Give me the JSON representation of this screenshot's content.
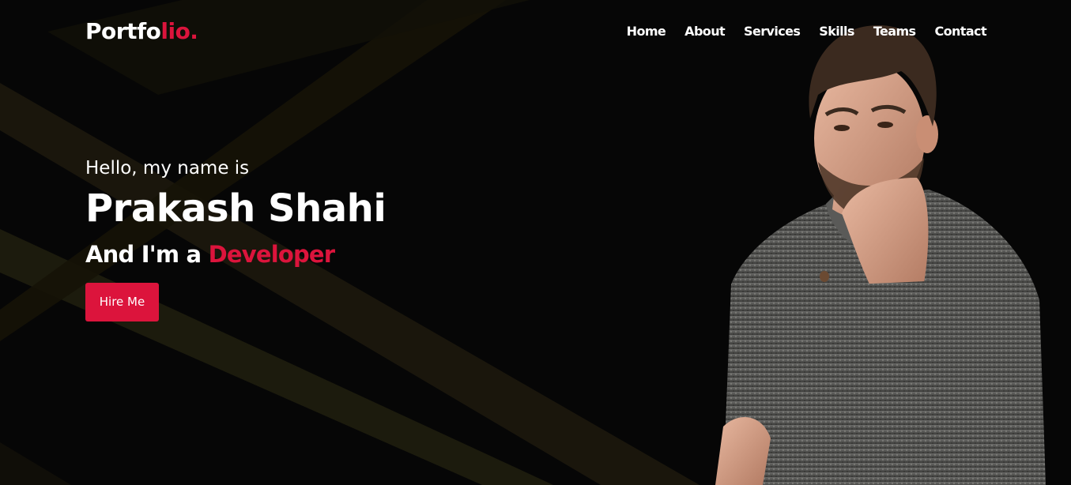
{
  "header": {
    "logo_main": "Portfo",
    "logo_accent": "lio."
  },
  "nav": {
    "items": [
      {
        "label": "Home"
      },
      {
        "label": "About"
      },
      {
        "label": "Services"
      },
      {
        "label": "Skills"
      },
      {
        "label": "Teams"
      },
      {
        "label": "Contact"
      }
    ]
  },
  "hero": {
    "greeting": "Hello, my name is",
    "name": "Prakash Shahi",
    "role_prefix": "And I'm a ",
    "role_accent": "Developer",
    "cta_label": "Hire Me"
  },
  "colors": {
    "accent": "#dc143c",
    "background": "#060606",
    "text": "#ffffff"
  }
}
